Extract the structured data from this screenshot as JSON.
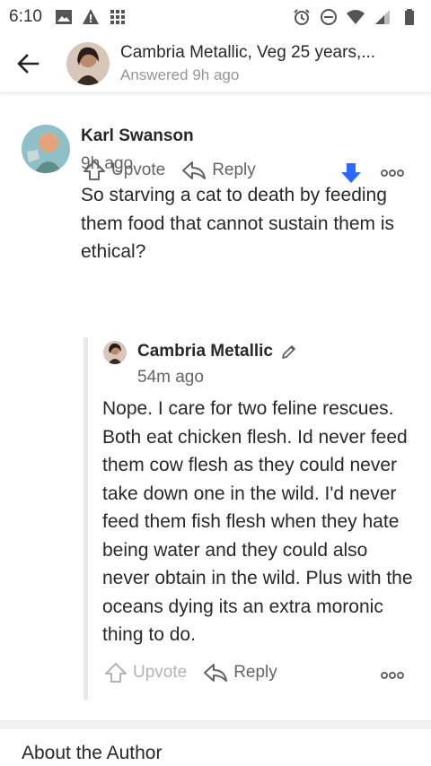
{
  "status_bar": {
    "time": "6:10",
    "icons_left": [
      "image-icon",
      "warning-icon",
      "grid-icon"
    ],
    "icons_right": [
      "alarm-icon",
      "do-not-disturb-icon",
      "wifi-icon",
      "signal-icon",
      "battery-icon"
    ]
  },
  "header": {
    "title": "Cambria Metallic, Veg 25 years,...",
    "subtitle": "Answered 9h ago"
  },
  "comment": {
    "author": "Karl Swanson",
    "time": "9h ago",
    "body": "So starving a cat to death by feeding them food that cannot sustain them is ethical?",
    "upvote_label": "Upvote",
    "reply_label": "Reply",
    "downvote_color": "#2e69ff"
  },
  "reply": {
    "author": "Cambria Metallic",
    "time": "54m ago",
    "body": "Nope. I care for two feline rescues. Both eat chicken flesh. Id never feed them cow flesh as they could never take down one in the wild. I'd never feed them fish flesh when they hate being water and they could also never obtain in the wild. Plus with the oceans dying its an extra moronic thing to do.",
    "upvote_label": "Upvote",
    "reply_label": "Reply"
  },
  "about_section": {
    "title": "About the Author"
  }
}
